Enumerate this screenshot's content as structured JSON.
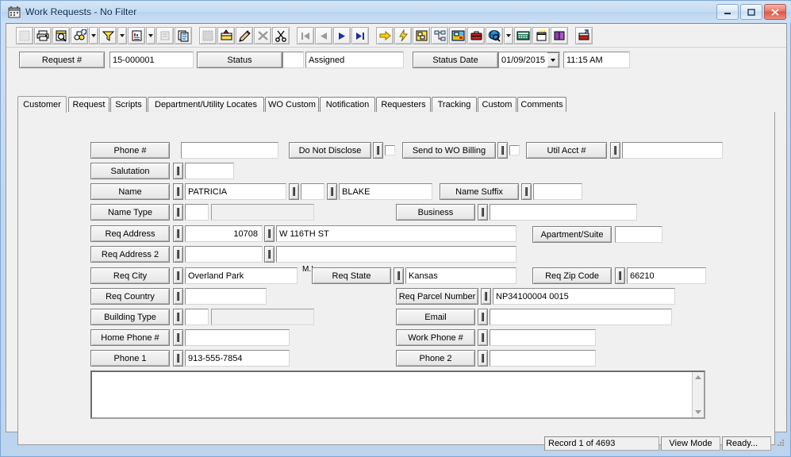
{
  "window": {
    "title": "Work Requests - No Filter",
    "icon": "calendar-icon",
    "minimize_label": "–",
    "maximize_label": "□",
    "close_label": "✕"
  },
  "toolbar": {
    "buttons": [
      {
        "name": "new-record",
        "title": "New"
      },
      {
        "name": "print",
        "title": "Print"
      },
      {
        "name": "print-preview",
        "title": "Print Preview"
      },
      {
        "name": "find",
        "title": "Find"
      },
      {
        "name": "find-dropdown",
        "title": "Find Options"
      },
      {
        "name": "filter",
        "title": "Filter"
      },
      {
        "name": "filter-dropdown",
        "title": "Filter Options"
      },
      {
        "name": "report",
        "title": "Report"
      },
      {
        "name": "report-dropdown",
        "title": "Report Options"
      },
      {
        "name": "properties",
        "title": "Properties"
      },
      {
        "name": "copy-record",
        "title": "Copy Record"
      },
      {
        "name": "save",
        "title": "Save"
      },
      {
        "name": "post",
        "title": "Post"
      },
      {
        "name": "edit",
        "title": "Edit"
      },
      {
        "name": "delete",
        "title": "Delete"
      },
      {
        "name": "cut",
        "title": "Cut"
      },
      {
        "name": "first-record",
        "title": "First Record"
      },
      {
        "name": "previous-record",
        "title": "Previous Record"
      },
      {
        "name": "next-record",
        "title": "Next Record"
      },
      {
        "name": "last-record",
        "title": "Last Record"
      },
      {
        "name": "goto",
        "title": "Go To"
      },
      {
        "name": "action",
        "title": "Action"
      },
      {
        "name": "layout",
        "title": "Layout"
      },
      {
        "name": "workflow",
        "title": "Workflow"
      },
      {
        "name": "map",
        "title": "Map"
      },
      {
        "name": "briefcase",
        "title": "Briefcase"
      },
      {
        "name": "globe-search",
        "title": "Web Search"
      },
      {
        "name": "globe-dropdown",
        "title": "Web Search Options"
      },
      {
        "name": "calculator",
        "title": "Calculator"
      },
      {
        "name": "new-window",
        "title": "New Window"
      },
      {
        "name": "help-book",
        "title": "Help"
      },
      {
        "name": "exit",
        "title": "Exit"
      }
    ]
  },
  "header": {
    "request_label": "Request #",
    "request_value": "15-000001",
    "status_label": "Status",
    "status_code": "",
    "status_value": "Assigned",
    "status_date_label": "Status Date",
    "status_date_value": "01/09/2015",
    "status_time_value": "11:15 AM"
  },
  "tabs": [
    {
      "label": "Customer",
      "active": true
    },
    {
      "label": "Request",
      "active": false
    },
    {
      "label": "Scripts",
      "active": false
    },
    {
      "label": "Department/Utility Locates",
      "active": false
    },
    {
      "label": "WO Custom",
      "active": false
    },
    {
      "label": "Notification",
      "active": false
    },
    {
      "label": "Requesters",
      "active": false
    },
    {
      "label": "Tracking",
      "active": false
    },
    {
      "label": "Custom",
      "active": false
    },
    {
      "label": "Comments",
      "active": false
    }
  ],
  "form": {
    "mi_label": "M.I.",
    "phone_label": "Phone #",
    "phone_value": "",
    "do_not_disclose_label": "Do Not Disclose",
    "do_not_disclose_checked": false,
    "send_to_wo_billing_label": "Send to WO Billing",
    "send_to_wo_billing_checked": false,
    "util_acct_label": "Util Acct #",
    "util_acct_value": "",
    "salutation_label": "Salutation",
    "salutation_value": "",
    "name_label": "Name",
    "first_name_value": "PATRICIA",
    "middle_initial_value": "",
    "last_name_value": "BLAKE",
    "name_suffix_label": "Name Suffix",
    "name_suffix_value": "",
    "name_type_label": "Name Type",
    "name_type_code": "",
    "name_type_value": "",
    "business_label": "Business",
    "business_value": "",
    "req_address_label": "Req Address",
    "req_address_number": "10708",
    "req_address_street": "W 116TH ST",
    "apartment_suite_label": "Apartment/Suite",
    "apartment_suite_value": "",
    "req_address2_label": "Req Address 2",
    "req_address2_number": "",
    "req_address2_street": "",
    "req_city_label": "Req City",
    "req_city_value": "Overland Park",
    "req_state_label": "Req State",
    "req_state_value": "Kansas",
    "req_zip_label": "Req Zip Code",
    "req_zip_value": "66210",
    "req_country_label": "Req Country",
    "req_country_value": "",
    "req_parcel_label": "Req Parcel Number",
    "req_parcel_value": "NP34100004 0015",
    "building_type_label": "Building Type",
    "building_type_code": "",
    "building_type_value": "",
    "email_label": "Email",
    "email_value": "",
    "home_phone_label": "Home Phone #",
    "home_phone_value": "",
    "work_phone_label": "Work Phone #",
    "work_phone_value": "",
    "phone1_label": "Phone 1",
    "phone1_value": "913-555-7854",
    "phone2_label": "Phone 2",
    "phone2_value": "",
    "notes_value": ""
  },
  "statusbar": {
    "record_text": "Record 1 of 4693",
    "mode_text": "View Mode",
    "ready_text": "Ready..."
  }
}
